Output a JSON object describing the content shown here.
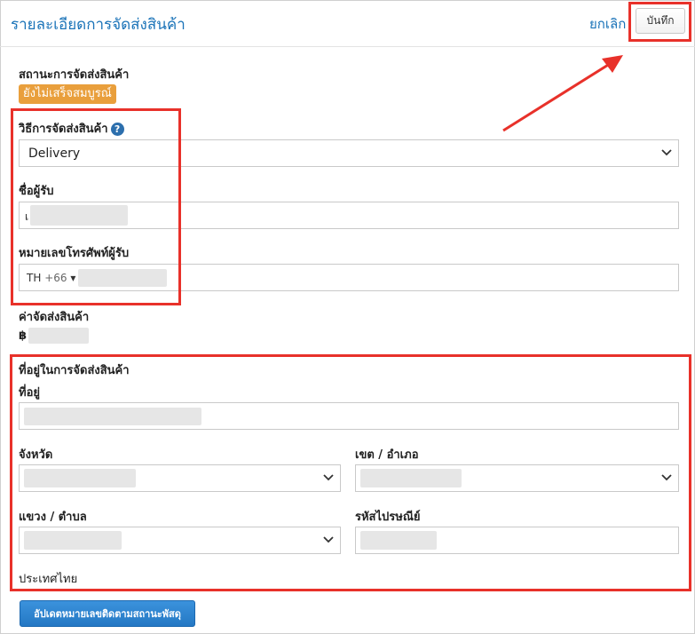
{
  "header": {
    "title": "รายละเอียดการจัดส่งสินค้า",
    "cancel_label": "ยกเลิก",
    "save_label": "บันทึก"
  },
  "shipping_status": {
    "label": "สถานะการจัดส่งสินค้า",
    "badge": "ยังไม่เสร็จสมบูรณ์"
  },
  "shipping_method": {
    "label": "วิธีการจัดส่งสินค้า",
    "help_icon": "question-circle-icon",
    "value": "Delivery"
  },
  "recipient_name": {
    "label": "ชื่อผู้รับ",
    "value_prefix": "เ"
  },
  "recipient_phone": {
    "label": "หมายเลขโทรศัพท์ผู้รับ",
    "country": "TH",
    "dial_code": "+66",
    "caret": "▾"
  },
  "shipping_fee": {
    "label": "ค่าจัดส่งสินค้า",
    "currency_symbol": "฿"
  },
  "address_section": {
    "heading": "ที่อยู่ในการจัดส่งสินค้า",
    "address_label": "ที่อยู่",
    "province_label": "จังหวัด",
    "district_label": "เขต / อำเภอ",
    "subdistrict_label": "แขวง / ตำบล",
    "postcode_label": "รหัสไปรษณีย์",
    "country": "ประเทศไทย"
  },
  "update_tracking_button": "อัปเดตหมายเลขติดตามสถานะพัสดุ",
  "colors": {
    "accent": "#1a73b8",
    "badge": "#e99f3c",
    "highlight": "#e8312a",
    "primary_button": "#2478c4"
  }
}
